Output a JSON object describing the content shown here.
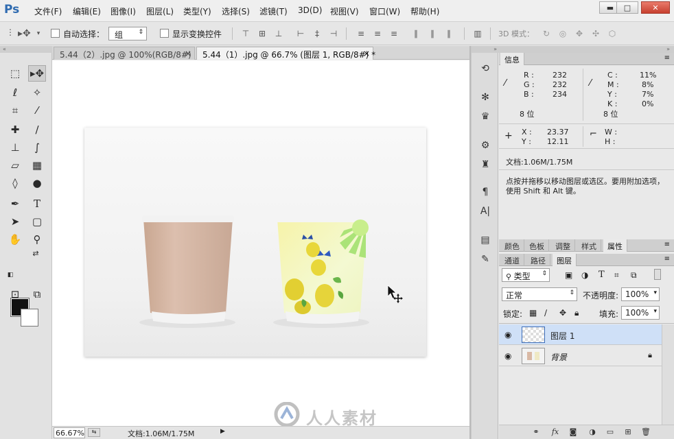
{
  "app": {
    "logo": "Ps"
  },
  "menu": [
    "文件(F)",
    "编辑(E)",
    "图像(I)",
    "图层(L)",
    "类型(Y)",
    "选择(S)",
    "滤镜(T)",
    "3D(D)",
    "视图(V)",
    "窗口(W)",
    "帮助(H)"
  ],
  "window_controls": {
    "minimize": "▬",
    "maximize": "□",
    "close": "✕"
  },
  "options_bar": {
    "auto_select_label": "自动选择：",
    "auto_select_value": "组",
    "show_transform_label": "显示变换控件",
    "mode_3d_label": "3D 模式："
  },
  "tabs": [
    {
      "label": "5.44（2）.jpg @ 100%(RGB/8#)",
      "close": "×"
    },
    {
      "label": "5.44（1）.jpg @ 66.7% (图层 1, RGB/8#) *",
      "close": "×"
    }
  ],
  "status": {
    "zoom": "66.67%",
    "doc": "文档:1.06M/1.75M"
  },
  "watermark": {
    "text": "人人素材"
  },
  "info_panel": {
    "title": "信息",
    "r_label": "R :",
    "r": "232",
    "g_label": "G :",
    "g": "232",
    "b_label": "B :",
    "b": "234",
    "bit_left": "8 位",
    "c_label": "C :",
    "c": "11%",
    "m_label": "M :",
    "m": "8%",
    "y_label": "Y :",
    "y": "7%",
    "k_label": "K :",
    "k": "0%",
    "bit_right": "8 位",
    "x_label": "X :",
    "x": "23.37",
    "yy_label": "Y :",
    "yy": "12.11",
    "w_label": "W :",
    "h_label": "H :",
    "doc": "文档:1.06M/1.75M",
    "hint": "点按并拖移以移动图层或选区。要用附加选项，使用 Shift 和 Alt 键。"
  },
  "mid_tabs": [
    "颜色",
    "色板",
    "调整",
    "样式",
    "属性"
  ],
  "layer_tabs": [
    "通道",
    "路径",
    "图层"
  ],
  "layers_panel": {
    "filter_kind": "类型",
    "blend_mode": "正常",
    "opacity_label": "不透明度:",
    "opacity": "100%",
    "lock_label": "锁定:",
    "fill_label": "填充:",
    "fill": "100%",
    "layers": [
      {
        "name": "图层 1",
        "selected": true
      },
      {
        "name": "背景",
        "selected": false
      }
    ]
  },
  "colors": {
    "cup_left": "#d9b9a5",
    "cup_right_bg": "#f1f6c1",
    "lemon": "#e8d73a",
    "selected_layer": "#cfe0f7"
  }
}
